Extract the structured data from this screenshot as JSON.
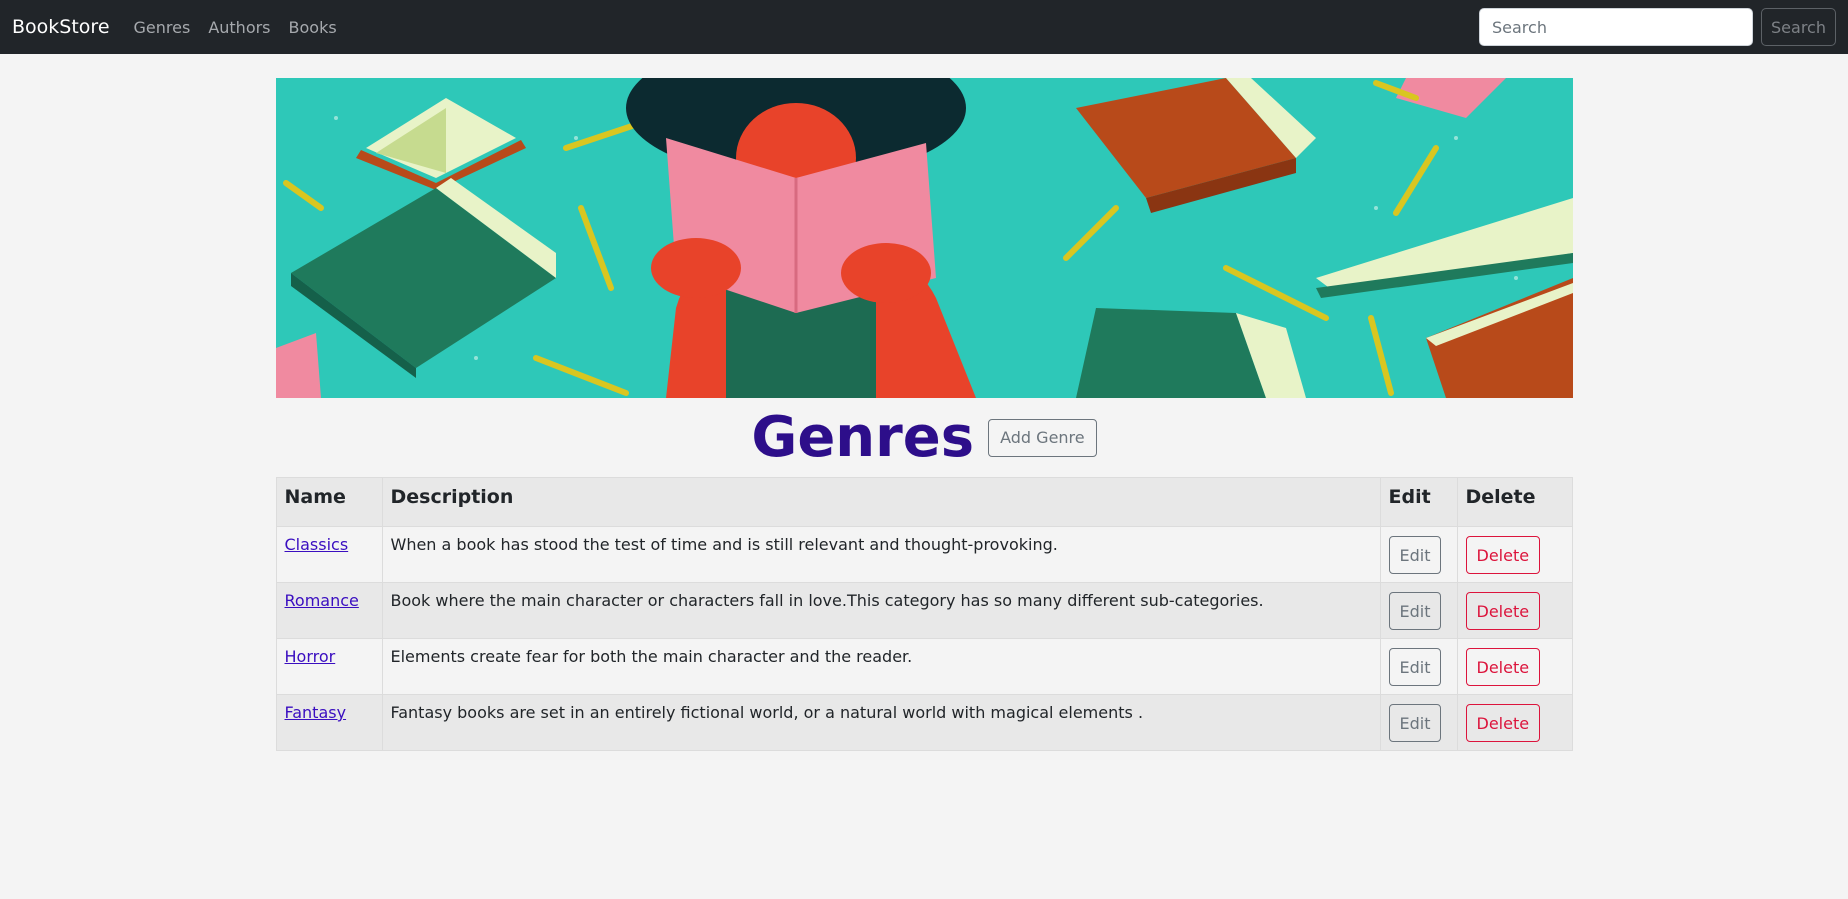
{
  "navbar": {
    "brand": "BookStore",
    "links": [
      "Genres",
      "Authors",
      "Books"
    ],
    "search_placeholder": "Search",
    "search_button": "Search"
  },
  "banner": {
    "colors": {
      "background": "#2ec8b8",
      "book_green": "#1f7a5c",
      "book_orange": "#b84a1a",
      "book_pink": "#f08aa0",
      "pages": "#e8f3c8",
      "figure": "#e8432a",
      "hair": "#0c2a30"
    }
  },
  "page": {
    "title": "Genres",
    "add_button": "Add Genre",
    "title_color": "#2d0e8a"
  },
  "table": {
    "headers": [
      "Name",
      "Description",
      "Edit",
      "Delete"
    ],
    "rows": [
      {
        "name": "Classics",
        "description": "When a book has stood the test of time and is still relevant and thought-provoking.",
        "edit": "Edit",
        "delete": "Delete"
      },
      {
        "name": "Romance",
        "description": "Book where the main character or characters fall in love.This category has so many different sub-categories.",
        "edit": "Edit",
        "delete": "Delete"
      },
      {
        "name": "Horror",
        "description": "Elements create fear for both the main character and the reader.",
        "edit": "Edit",
        "delete": "Delete"
      },
      {
        "name": "Fantasy",
        "description": "Fantasy books are set in an entirely fictional world, or a natural world with magical elements .",
        "edit": "Edit",
        "delete": "Delete"
      }
    ]
  }
}
